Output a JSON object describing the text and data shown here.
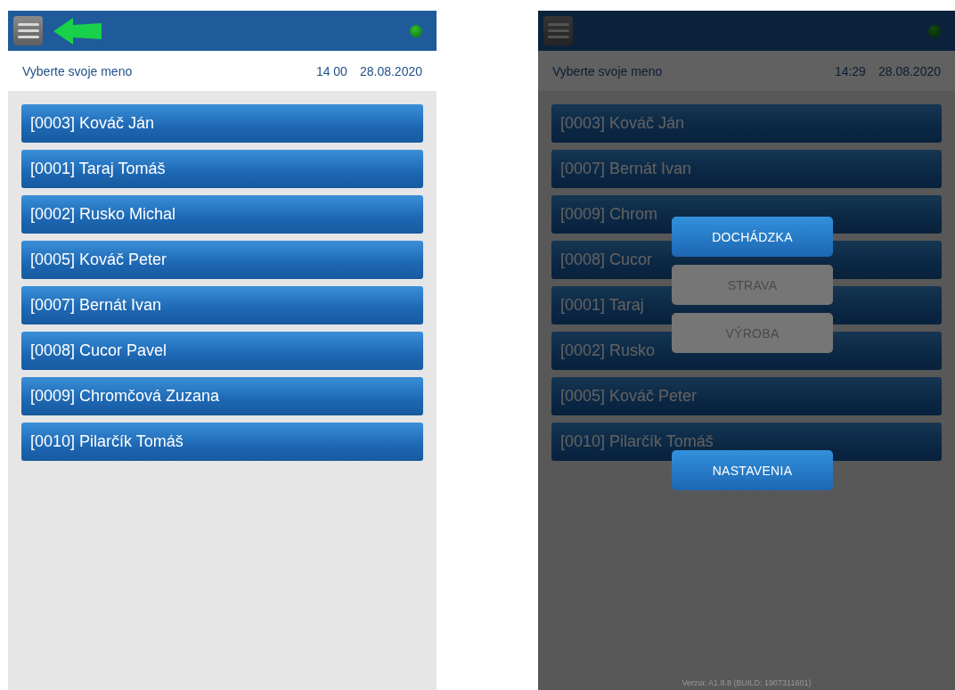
{
  "screens": [
    {
      "title": "Vyberte svoje meno",
      "time": "14 00",
      "date": "28.08.2020",
      "pointer_arrow": true,
      "employees": [
        "[0003] Kováč Ján",
        "[0001] Taraj Tomáš",
        "[0002] Rusko Michal",
        "[0005] Kováč Peter",
        "[0007] Bernát Ivan",
        "[0008] Cucor Pavel",
        "[0009] Chromčová Zuzana",
        "[0010] Pilarčík Tomáš"
      ]
    },
    {
      "title": "Vyberte svoje meno",
      "time": "14:29",
      "date": "28.08.2020",
      "pointer_arrow": false,
      "employees": [
        "[0003] Kováč Ján",
        "[0007] Bernát Ivan",
        "[0009] Chrom",
        "[0008] Cucor",
        "[0001] Taraj",
        "[0002] Rusko",
        "[0005] Kováč Peter",
        "[0010] Pilarčík Tomáš"
      ],
      "menu": {
        "buttons": [
          {
            "label": "DOCHÁDZKA",
            "disabled": false
          },
          {
            "label": "STRAVA",
            "disabled": true
          },
          {
            "label": "VÝROBA",
            "disabled": true
          }
        ],
        "settings": {
          "label": "NASTAVENIA",
          "disabled": false
        },
        "version": "Verzia: A1.8.8 (BUILD: 1907311601)"
      }
    }
  ]
}
